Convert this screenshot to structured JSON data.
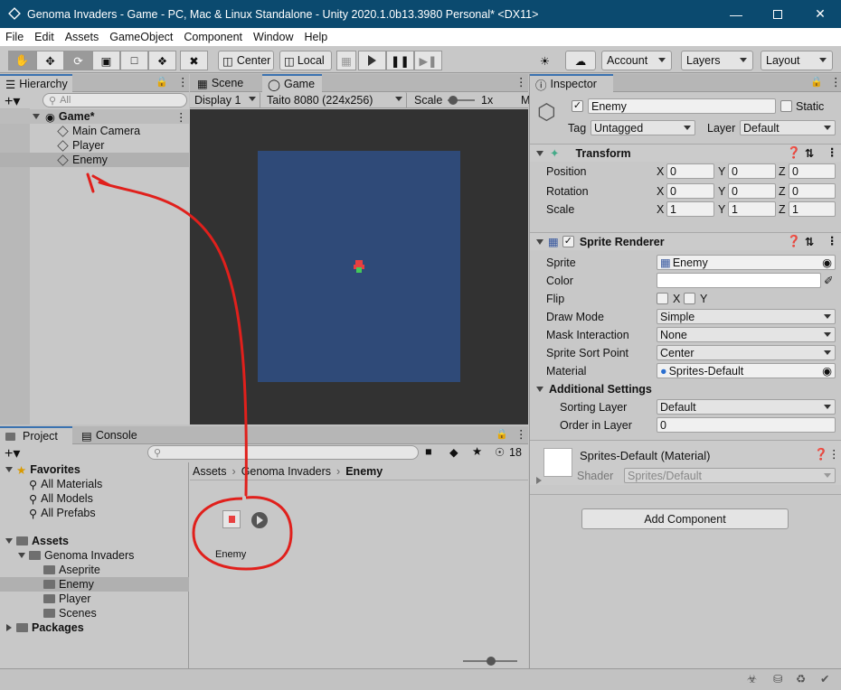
{
  "window": {
    "title": "Genoma Invaders - Game - PC, Mac & Linux Standalone - Unity 2020.1.0b13.3980 Personal* <DX11>"
  },
  "menu": [
    "File",
    "Edit",
    "Assets",
    "GameObject",
    "Component",
    "Window",
    "Help"
  ],
  "toolbar": {
    "center": "Center",
    "local": "Local",
    "account": "Account",
    "layers": "Layers",
    "layout": "Layout"
  },
  "hierarchy": {
    "tab": "Hierarchy",
    "search_placeholder": "All",
    "scene": "Game*",
    "items": [
      "Main Camera",
      "Player",
      "Enemy"
    ]
  },
  "view": {
    "scene_tab": "Scene",
    "game_tab": "Game",
    "display": "Display 1",
    "resolution": "Taito 8080 (224x256)",
    "scale_label": "Scale",
    "scale_value": "1x",
    "maximize": "M",
    "bg_color": "#2f4a78",
    "frame_color": "#323232"
  },
  "project": {
    "tab": "Project",
    "console_tab": "Console",
    "hidden_count": "18",
    "favorites": {
      "label": "Favorites",
      "items": [
        "All Materials",
        "All Models",
        "All Prefabs"
      ]
    },
    "assets": {
      "label": "Assets",
      "genoma": "Genoma Invaders",
      "children": [
        "Aseprite",
        "Enemy",
        "Player",
        "Scenes"
      ]
    },
    "packages": "Packages",
    "breadcrumb": [
      "Assets",
      "Genoma Invaders",
      "Enemy"
    ],
    "asset_name": "Enemy"
  },
  "inspector": {
    "tab": "Inspector",
    "object_name": "Enemy",
    "static_label": "Static",
    "tag_label": "Tag",
    "tag_value": "Untagged",
    "layer_label": "Layer",
    "layer_value": "Default",
    "transform": {
      "title": "Transform",
      "rows": [
        {
          "label": "Position",
          "x": "0",
          "y": "0",
          "z": "0"
        },
        {
          "label": "Rotation",
          "x": "0",
          "y": "0",
          "z": "0"
        },
        {
          "label": "Scale",
          "x": "1",
          "y": "1",
          "z": "1"
        }
      ]
    },
    "sprite_renderer": {
      "title": "Sprite Renderer",
      "sprite_label": "Sprite",
      "sprite_value": "Enemy",
      "color_label": "Color",
      "flip_label": "Flip",
      "flip_x": "X",
      "flip_y": "Y",
      "draw_mode_label": "Draw Mode",
      "draw_mode_value": "Simple",
      "mask_label": "Mask Interaction",
      "mask_value": "None",
      "sort_point_label": "Sprite Sort Point",
      "sort_point_value": "Center",
      "material_label": "Material",
      "material_value": "Sprites-Default",
      "additional": "Additional Settings",
      "sorting_layer_label": "Sorting Layer",
      "sorting_layer_value": "Default",
      "order_label": "Order in Layer",
      "order_value": "0"
    },
    "material": {
      "title": "Sprites-Default (Material)",
      "shader_label": "Shader",
      "shader_value": "Sprites/Default"
    },
    "add_component": "Add Component"
  },
  "colors": {
    "annotation": "#e0201c",
    "accent": "#3a72b0"
  }
}
